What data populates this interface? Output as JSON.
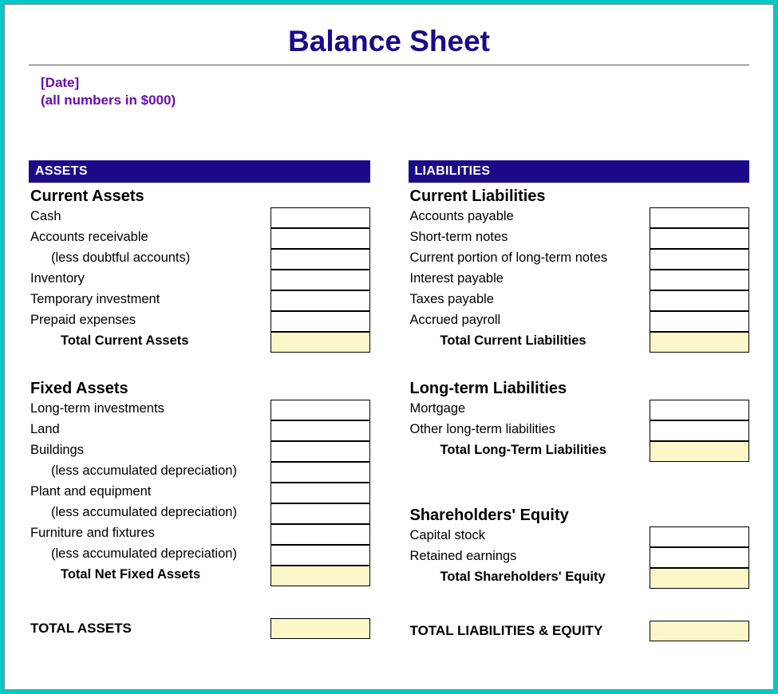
{
  "title": "Balance Sheet",
  "date_placeholder": "[Date]",
  "units_note": "(all numbers in $000)",
  "assets": {
    "header": "ASSETS",
    "current": {
      "subheader": "Current Assets",
      "items": [
        {
          "label": "Cash",
          "value": ""
        },
        {
          "label": "Accounts receivable",
          "value": ""
        },
        {
          "label": "(less doubtful accounts)",
          "value": "",
          "indent": true
        },
        {
          "label": "Inventory",
          "value": ""
        },
        {
          "label": "Temporary investment",
          "value": ""
        },
        {
          "label": "Prepaid expenses",
          "value": ""
        }
      ],
      "total_label": "Total Current Assets",
      "total_value": ""
    },
    "fixed": {
      "subheader": "Fixed Assets",
      "items": [
        {
          "label": "Long-term investments",
          "value": ""
        },
        {
          "label": "Land",
          "value": ""
        },
        {
          "label": "Buildings",
          "value": ""
        },
        {
          "label": "(less accumulated depreciation)",
          "value": "",
          "indent": true
        },
        {
          "label": "Plant and equipment",
          "value": ""
        },
        {
          "label": "(less accumulated depreciation)",
          "value": "",
          "indent": true
        },
        {
          "label": "Furniture and fixtures",
          "value": ""
        },
        {
          "label": "(less accumulated depreciation)",
          "value": "",
          "indent": true
        }
      ],
      "total_label": "Total Net Fixed Assets",
      "total_value": ""
    },
    "grand_label": "TOTAL ASSETS",
    "grand_value": ""
  },
  "liabilities": {
    "header": "LIABILITIES",
    "current": {
      "subheader": "Current Liabilities",
      "items": [
        {
          "label": "Accounts payable",
          "value": ""
        },
        {
          "label": "Short-term notes",
          "value": ""
        },
        {
          "label": "Current portion of long-term notes",
          "value": ""
        },
        {
          "label": "Interest payable",
          "value": ""
        },
        {
          "label": "Taxes payable",
          "value": ""
        },
        {
          "label": "Accrued payroll",
          "value": ""
        }
      ],
      "total_label": "Total Current Liabilities",
      "total_value": ""
    },
    "longterm": {
      "subheader": "Long-term Liabilities",
      "items": [
        {
          "label": "Mortgage",
          "value": ""
        },
        {
          "label": "Other long-term liabilities",
          "value": ""
        }
      ],
      "total_label": "Total Long-Term Liabilities",
      "total_value": ""
    },
    "equity": {
      "subheader": "Shareholders' Equity",
      "items": [
        {
          "label": "Capital stock",
          "value": ""
        },
        {
          "label": "Retained earnings",
          "value": ""
        }
      ],
      "total_label": "Total Shareholders' Equity",
      "total_value": ""
    },
    "grand_label": "TOTAL LIABILITIES & EQUITY",
    "grand_value": ""
  }
}
